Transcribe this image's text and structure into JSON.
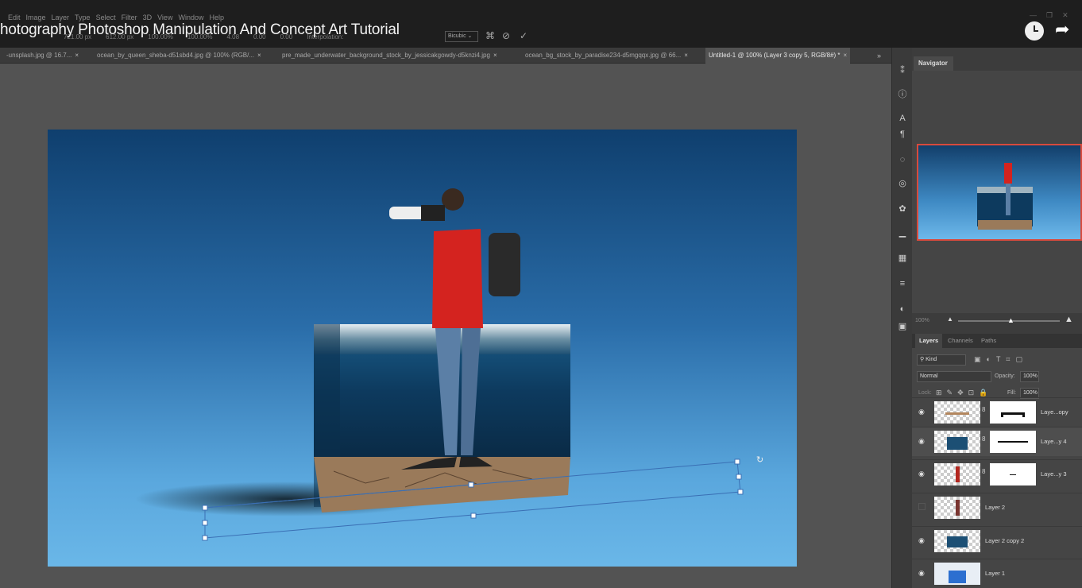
{
  "menu": [
    "Edit",
    "Image",
    "Layer",
    "Type",
    "Select",
    "Filter",
    "3D",
    "View",
    "Window",
    "Help"
  ],
  "video_title": "hotography Photoshop Manipulation And Concept Art Tutorial",
  "options": {
    "items": [
      "721.00 px",
      "612.00 px",
      "100.00%",
      "100.00%",
      "4.08",
      "0.00",
      "0.00"
    ],
    "interpolation_label": "Interpolation:",
    "interpolation_value": "Bicubic"
  },
  "tabs": [
    {
      "label": "-unsplash.jpg @ 16.7...",
      "active": false
    },
    {
      "label": "ocean_by_queen_sheba-d51sbd4.jpg @ 100% (RGB/...",
      "active": false
    },
    {
      "label": "pre_made_underwater_background_stock_by_jessicakgowdy-d5knzi4.jpg",
      "active": false
    },
    {
      "label": "ocean_bg_stock_by_paradise234-d5mgqqx.jpg @ 66...",
      "active": false
    },
    {
      "label": "Untitled-1 @ 100% (Layer 3 copy 5, RGB/8#) *",
      "active": true
    }
  ],
  "tab_close": "×",
  "tab_more": "»",
  "navigator": {
    "title": "Navigator",
    "zoom": "100%"
  },
  "layers_panel": {
    "tabs": [
      "Layers",
      "Channels",
      "Paths"
    ],
    "kind_placeholder": "Kind",
    "blend_mode": "Normal",
    "opacity_label": "Opacity:",
    "opacity_value": "100%",
    "lock_label": "Lock:",
    "fill_label": "Fill:",
    "fill_value": "100%",
    "layers": [
      {
        "name": "Laye...opy",
        "visible": true,
        "mask": true
      },
      {
        "name": "Laye...y 4",
        "visible": true,
        "mask": true
      },
      {
        "name": "Laye...y 3",
        "visible": true,
        "mask": true
      },
      {
        "name": "Layer 2",
        "visible": false,
        "mask": false
      },
      {
        "name": "Layer 2 copy 2",
        "visible": true,
        "mask": false
      },
      {
        "name": "Layer 1",
        "visible": true,
        "mask": false
      }
    ]
  },
  "colors": {
    "accent_red": "#d94a3c",
    "canvas_top": "#0f3f6e",
    "canvas_bottom": "#6ab7e8",
    "panel_bg": "#454545"
  }
}
